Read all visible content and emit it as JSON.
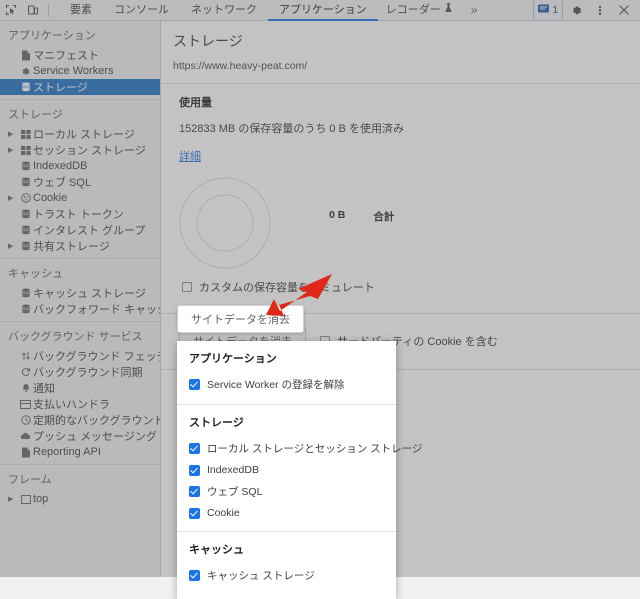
{
  "toolbar": {
    "inspect_icon": "inspect-element-icon",
    "device_icon": "device-toolbar-icon",
    "tabs": [
      {
        "label": "要素",
        "active": false
      },
      {
        "label": "コンソール",
        "active": false
      },
      {
        "label": "ネットワーク",
        "active": false
      },
      {
        "label": "アプリケーション",
        "active": true
      }
    ],
    "recorder_label": "レコーダー",
    "recorder_icon": "flask-icon",
    "overflow_label": "»",
    "issues_count": "1",
    "issues_icon": "message-icon",
    "settings_icon": "gear-icon",
    "more_icon": "kebab-menu-icon",
    "close_icon": "close-icon"
  },
  "sidebar": {
    "sections": [
      {
        "title": "アプリケーション",
        "items": [
          {
            "label": "マニフェスト",
            "icon": "document-icon",
            "expandable": false,
            "selected": false
          },
          {
            "label": "Service Workers",
            "icon": "gear-icon",
            "expandable": false,
            "selected": false
          },
          {
            "label": "ストレージ",
            "icon": "database-icon",
            "expandable": false,
            "selected": true
          }
        ]
      },
      {
        "title": "ストレージ",
        "items": [
          {
            "label": "ローカル ストレージ",
            "icon": "table-icon",
            "expandable": true,
            "selected": false
          },
          {
            "label": "セッション ストレージ",
            "icon": "table-icon",
            "expandable": true,
            "selected": false
          },
          {
            "label": "IndexedDB",
            "icon": "database-icon",
            "expandable": false,
            "selected": false
          },
          {
            "label": "ウェブ SQL",
            "icon": "database-icon",
            "expandable": false,
            "selected": false
          },
          {
            "label": "Cookie",
            "icon": "cookie-icon",
            "expandable": true,
            "selected": false
          },
          {
            "label": "トラスト トークン",
            "icon": "database-icon",
            "expandable": false,
            "selected": false
          },
          {
            "label": "インタレスト グループ",
            "icon": "database-icon",
            "expandable": false,
            "selected": false
          },
          {
            "label": "共有ストレージ",
            "icon": "database-icon",
            "expandable": true,
            "selected": false
          }
        ]
      },
      {
        "title": "キャッシュ",
        "items": [
          {
            "label": "キャッシュ ストレージ",
            "icon": "database-icon",
            "expandable": false,
            "selected": false
          },
          {
            "label": "バックフォワード キャッシュ",
            "icon": "database-icon",
            "expandable": false,
            "selected": false
          }
        ]
      },
      {
        "title": "バックグラウンド サービス",
        "items": [
          {
            "label": "バックグラウンド フェッチ",
            "icon": "updown-arrow-icon",
            "expandable": false,
            "selected": false
          },
          {
            "label": "バックグラウンド同期",
            "icon": "sync-icon",
            "expandable": false,
            "selected": false
          },
          {
            "label": "通知",
            "icon": "bell-icon",
            "expandable": false,
            "selected": false
          },
          {
            "label": "支払いハンドラ",
            "icon": "card-icon",
            "expandable": false,
            "selected": false
          },
          {
            "label": "定期的なバックグラウンド同",
            "icon": "clock-icon",
            "expandable": false,
            "selected": false
          },
          {
            "label": "プッシュ メッセージング",
            "icon": "cloud-icon",
            "expandable": false,
            "selected": false
          },
          {
            "label": "Reporting API",
            "icon": "document-icon",
            "expandable": false,
            "selected": false
          }
        ]
      },
      {
        "title": "フレーム",
        "items": [
          {
            "label": "top",
            "icon": "frame-icon",
            "expandable": true,
            "selected": false
          }
        ]
      }
    ]
  },
  "main": {
    "title": "ストレージ",
    "url": "https://www.heavy-peat.com/",
    "usage_heading": "使用量",
    "usage_text": "152833 MB の保存容量のうち 0 B を使用済み",
    "detail_link": "詳細",
    "legend_value": "0 B",
    "legend_label": "合計",
    "simulate_label": "カスタムの保存容量をシミュレート",
    "clear_button": "サイトデータを消去",
    "third_party_label": "サードパーティの Cookie を含む"
  },
  "dropdown": {
    "groups": [
      {
        "title": "アプリケーション",
        "items": [
          {
            "label": "Service Worker の登録を解除",
            "checked": true
          }
        ]
      },
      {
        "title": "ストレージ",
        "items": [
          {
            "label": "ローカル ストレージとセッション ストレージ",
            "checked": true
          },
          {
            "label": "IndexedDB",
            "checked": true
          },
          {
            "label": "ウェブ SQL",
            "checked": true
          },
          {
            "label": "Cookie",
            "checked": true
          }
        ]
      },
      {
        "title": "キャッシュ",
        "items": [
          {
            "label": "キャッシュ ストレージ",
            "checked": true
          }
        ]
      }
    ]
  },
  "annotation": {
    "arrow_color": "#e02718",
    "arrow_name": "red-pointer-arrow"
  },
  "colors": {
    "accent": "#1a73e8",
    "selected_row": "#1a6fc4",
    "dim": "rgba(105,105,105,0.40)"
  }
}
